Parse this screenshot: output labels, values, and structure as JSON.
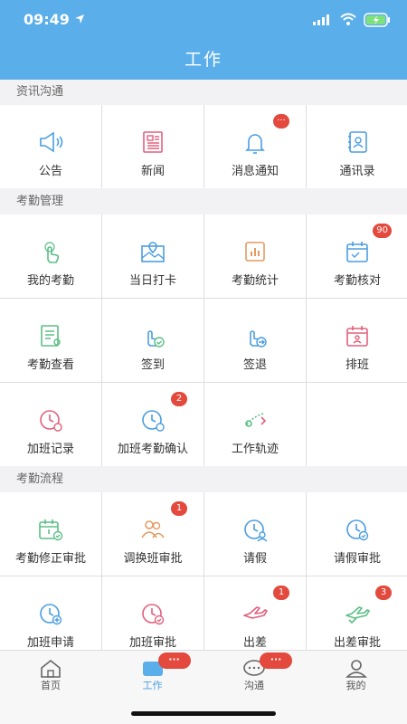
{
  "status": {
    "time": "09:49"
  },
  "nav": {
    "title": "工作"
  },
  "sections": [
    {
      "title": "资讯沟通",
      "items": [
        {
          "label": "公告",
          "icon": "megaphone-icon"
        },
        {
          "label": "新闻",
          "icon": "newspaper-icon"
        },
        {
          "label": "消息通知",
          "icon": "bell-icon",
          "badge": "···"
        },
        {
          "label": "通讯录",
          "icon": "contacts-icon"
        }
      ]
    },
    {
      "title": "考勤管理",
      "items": [
        {
          "label": "我的考勤",
          "icon": "tap-hand-icon"
        },
        {
          "label": "当日打卡",
          "icon": "map-pin-icon"
        },
        {
          "label": "考勤统计",
          "icon": "bar-chart-icon"
        },
        {
          "label": "考勤核对",
          "icon": "calendar-check-icon",
          "badge": "90"
        },
        {
          "label": "考勤查看",
          "icon": "doc-view-icon"
        },
        {
          "label": "签到",
          "icon": "sign-in-hand-icon"
        },
        {
          "label": "签退",
          "icon": "sign-out-hand-icon"
        },
        {
          "label": "排班",
          "icon": "schedule-calendar-icon"
        },
        {
          "label": "加班记录",
          "icon": "clock-record-icon"
        },
        {
          "label": "加班考勤确认",
          "icon": "clock-confirm-icon",
          "badge": "2"
        },
        {
          "label": "工作轨迹",
          "icon": "track-route-icon"
        }
      ]
    },
    {
      "title": "考勤流程",
      "items": [
        {
          "label": "考勤修正审批",
          "icon": "calendar-approve-icon"
        },
        {
          "label": "调换班审批",
          "icon": "people-swap-icon",
          "badge": "1"
        },
        {
          "label": "请假",
          "icon": "leave-clock-icon"
        },
        {
          "label": "请假审批",
          "icon": "leave-approve-icon"
        },
        {
          "label": "加班申请",
          "icon": "clock-plus-icon"
        },
        {
          "label": "加班审批",
          "icon": "clock-approve-icon"
        },
        {
          "label": "出差",
          "icon": "airplane-icon",
          "badge": "1"
        },
        {
          "label": "出差审批",
          "icon": "airplane-approve-icon",
          "badge": "3"
        }
      ]
    }
  ],
  "tabs": [
    {
      "label": "首页",
      "icon": "home-icon"
    },
    {
      "label": "工作",
      "icon": "work-icon",
      "badge": "···"
    },
    {
      "label": "沟通",
      "icon": "chat-icon",
      "badge": "···"
    },
    {
      "label": "我的",
      "icon": "profile-icon"
    }
  ],
  "colors": {
    "primary": "#5aaeea",
    "badge": "#e3493d",
    "green": "#5bbf86",
    "pink": "#e2607d",
    "orange": "#e59a62",
    "blue": "#4a9ee0"
  }
}
